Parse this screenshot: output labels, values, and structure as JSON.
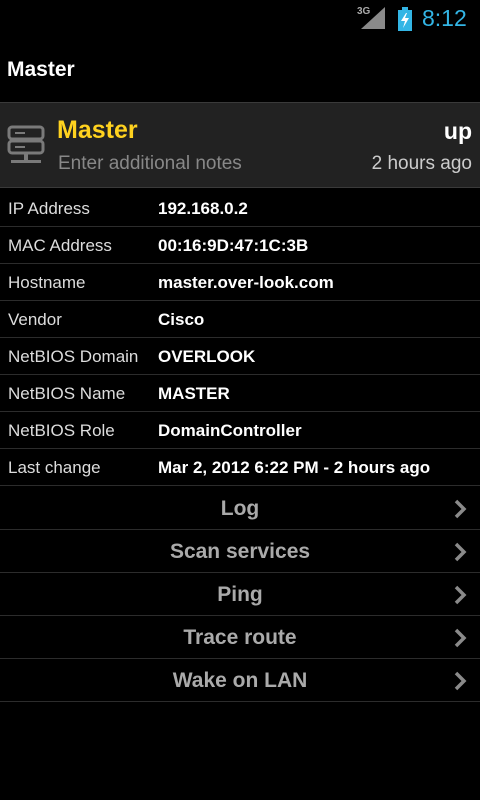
{
  "status_bar": {
    "network": "3G",
    "time": "8:12",
    "clock_color": "#33b5e5"
  },
  "action_bar": {
    "title": "Master"
  },
  "host": {
    "icon": "server-icon",
    "name": "Master",
    "name_color": "#ffd21f",
    "notes_placeholder": "Enter additional notes",
    "state": "up",
    "last_seen": "2 hours ago"
  },
  "details": [
    {
      "label": "IP Address",
      "value": "192.168.0.2"
    },
    {
      "label": "MAC Address",
      "value": "00:16:9D:47:1C:3B"
    },
    {
      "label": "Hostname",
      "value": "master.over-look.com"
    },
    {
      "label": "Vendor",
      "value": "Cisco"
    },
    {
      "label": "NetBIOS Domain",
      "value": "OVERLOOK"
    },
    {
      "label": "NetBIOS Name",
      "value": "MASTER"
    },
    {
      "label": "NetBIOS Role",
      "value": "DomainController"
    },
    {
      "label": "Last change",
      "value": "Mar 2, 2012 6:22 PM - 2 hours ago"
    }
  ],
  "actions": [
    {
      "label": "Log",
      "icon": "chevron-right-icon"
    },
    {
      "label": "Scan services",
      "icon": "chevron-right-icon"
    },
    {
      "label": "Ping",
      "icon": "chevron-right-icon"
    },
    {
      "label": "Trace route",
      "icon": "chevron-right-icon"
    },
    {
      "label": "Wake on LAN",
      "icon": "chevron-right-icon"
    }
  ]
}
